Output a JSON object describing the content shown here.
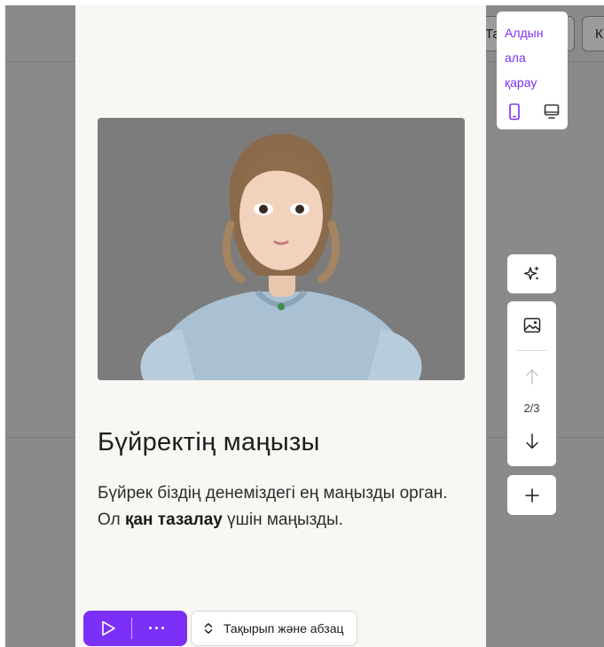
{
  "background": {
    "buttons": [
      {
        "label": "Та"
      },
      {
        "label": "К"
      }
    ]
  },
  "card": {
    "title": "Бүйректің маңызы",
    "paragraph": {
      "before": "Бүйрек біздің денеміздегі ең маңызды орган. Ол ",
      "bold": "қан тазалау",
      "after": " үшін маңызды."
    }
  },
  "bottom_bar": {
    "play": "play-icon",
    "more": "···",
    "layout_label": "Тақырып және абзац"
  },
  "preview_panel": {
    "label_lines": [
      "Алдын",
      "ала",
      "қарау"
    ],
    "icons": [
      "mobile-icon",
      "desktop-icon"
    ]
  },
  "side_tools": {
    "magic": "sparkle-icon",
    "image": "image-icon",
    "page_indicator": "2/3",
    "add": "plus-icon"
  },
  "colors": {
    "accent": "#7b2ff7",
    "overlay": "#8a8a8a",
    "card": "#f9f7f3"
  }
}
